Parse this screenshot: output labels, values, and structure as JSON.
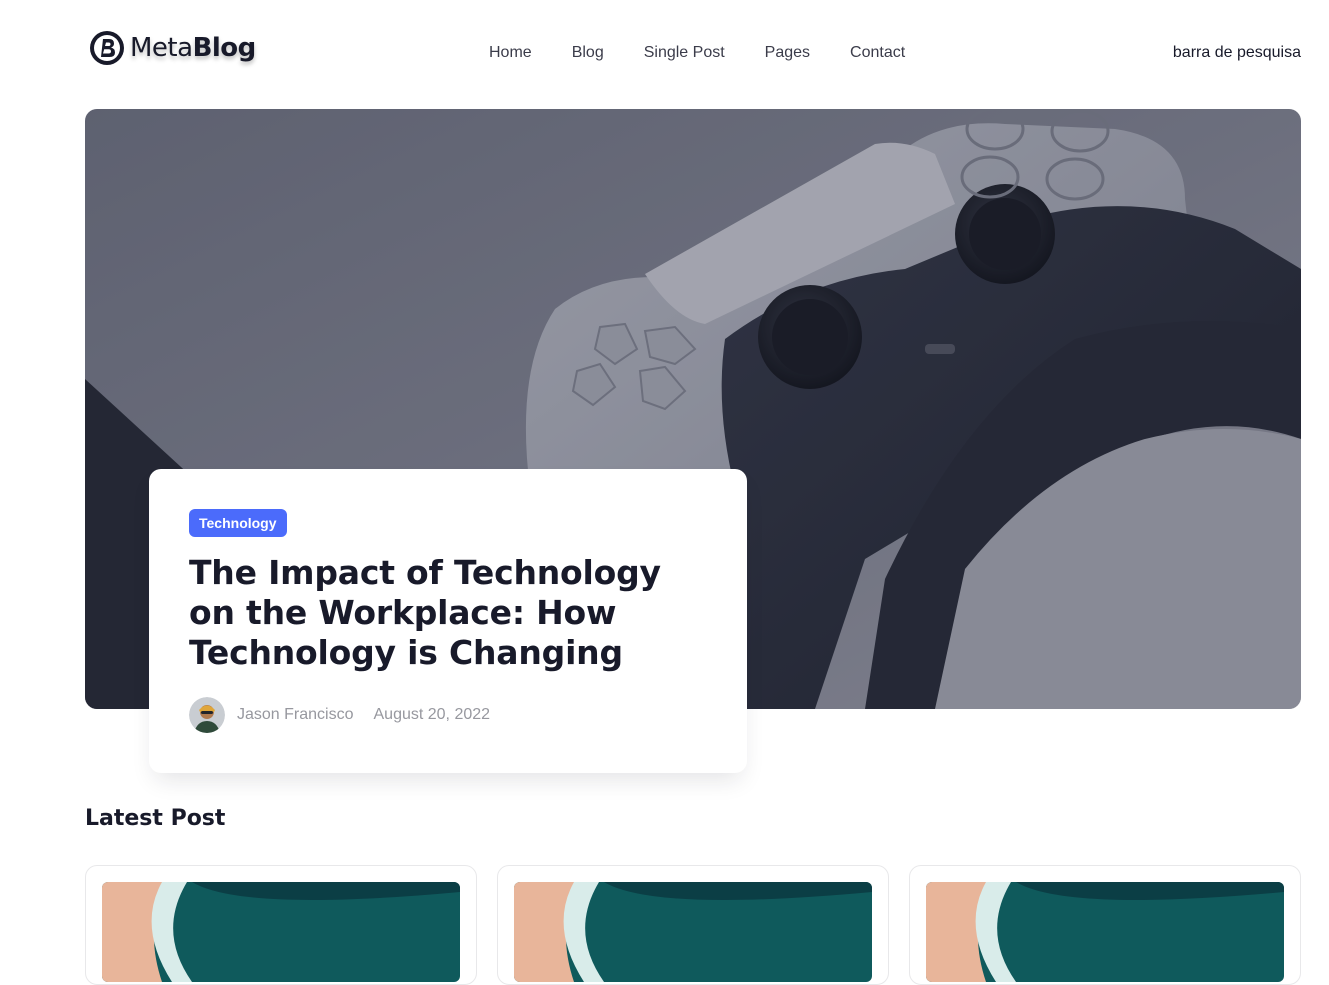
{
  "brand": {
    "name_light": "Meta",
    "name_bold": "Blog"
  },
  "nav": {
    "items": [
      {
        "label": "Home"
      },
      {
        "label": "Blog"
      },
      {
        "label": "Single Post"
      },
      {
        "label": "Pages"
      },
      {
        "label": "Contact"
      }
    ]
  },
  "search": {
    "label": "barra de pesquisa"
  },
  "featured": {
    "category": "Technology",
    "title": "The Impact of Technology on the Workplace: How Technology is Changing",
    "author": "Jason Francisco",
    "date": "August 20, 2022",
    "colors": {
      "badge": "#4b6bfb",
      "title": "#181a2a",
      "meta": "#97989f"
    }
  },
  "latest": {
    "heading": "Latest Post"
  }
}
